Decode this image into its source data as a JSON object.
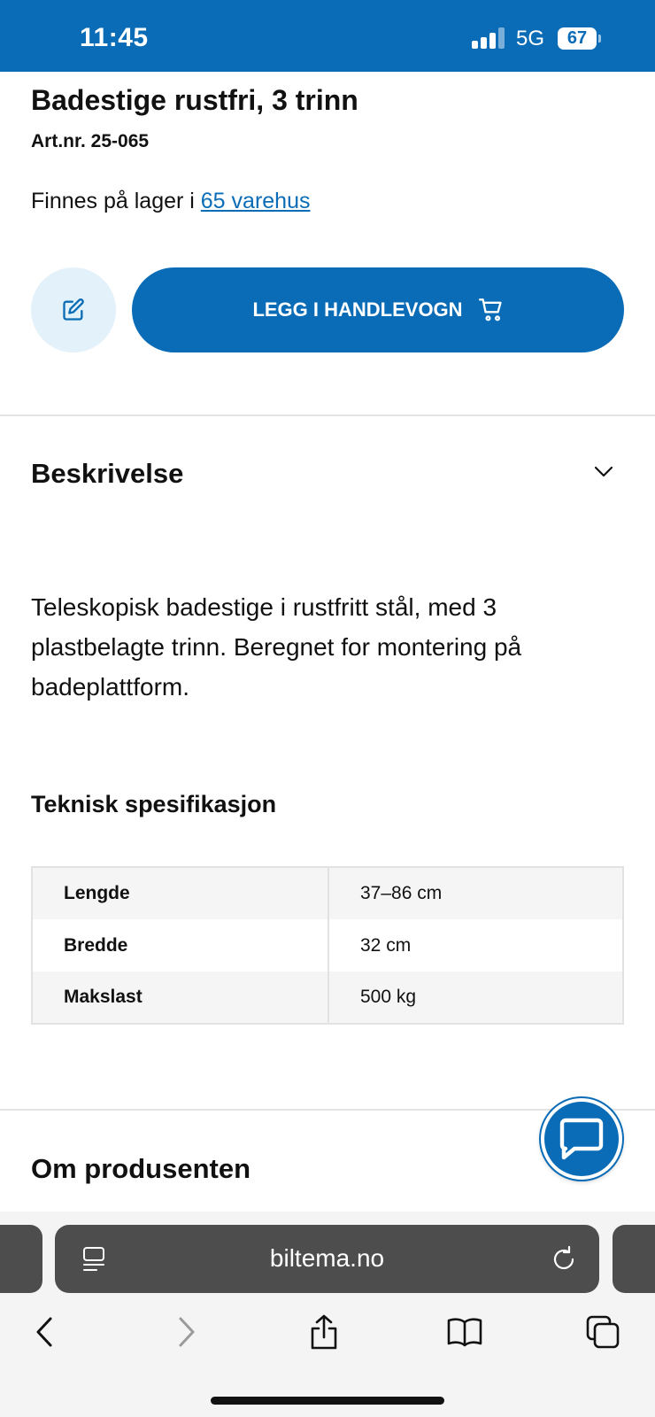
{
  "status_bar": {
    "time": "11:45",
    "network": "5G",
    "battery": "67"
  },
  "product": {
    "title": "Badestige rustfri, 3 trinn",
    "art_nr": "Art.nr. 25-065",
    "stock_prefix": "Finnes på lager i ",
    "stock_link": "65 varehus",
    "add_to_cart_label": "LEGG I HANDLEVOGN"
  },
  "description_section": {
    "heading": "Beskrivelse",
    "text": "Teleskopisk badestige i rustfritt stål, med 3 plastbelagte trinn. Beregnet for montering på badeplattform."
  },
  "specs": {
    "heading": "Teknisk spesifikasjon",
    "rows": [
      {
        "key": "Lengde",
        "value": "37–86 cm"
      },
      {
        "key": "Bredde",
        "value": "32 cm"
      },
      {
        "key": "Makslast",
        "value": "500 kg"
      }
    ]
  },
  "manufacturer_section": {
    "heading": "Om produsenten"
  },
  "browser": {
    "url": "biltema.no"
  },
  "colors": {
    "brand_blue": "#0a6cb6",
    "edit_button_bg": "#e3f1fa"
  },
  "icons": [
    "edit-icon",
    "cart-icon",
    "chevron-down-icon",
    "chat-icon",
    "reader-icon",
    "reload-icon",
    "back-icon",
    "forward-icon",
    "share-icon",
    "bookmarks-icon",
    "tabs-icon"
  ]
}
